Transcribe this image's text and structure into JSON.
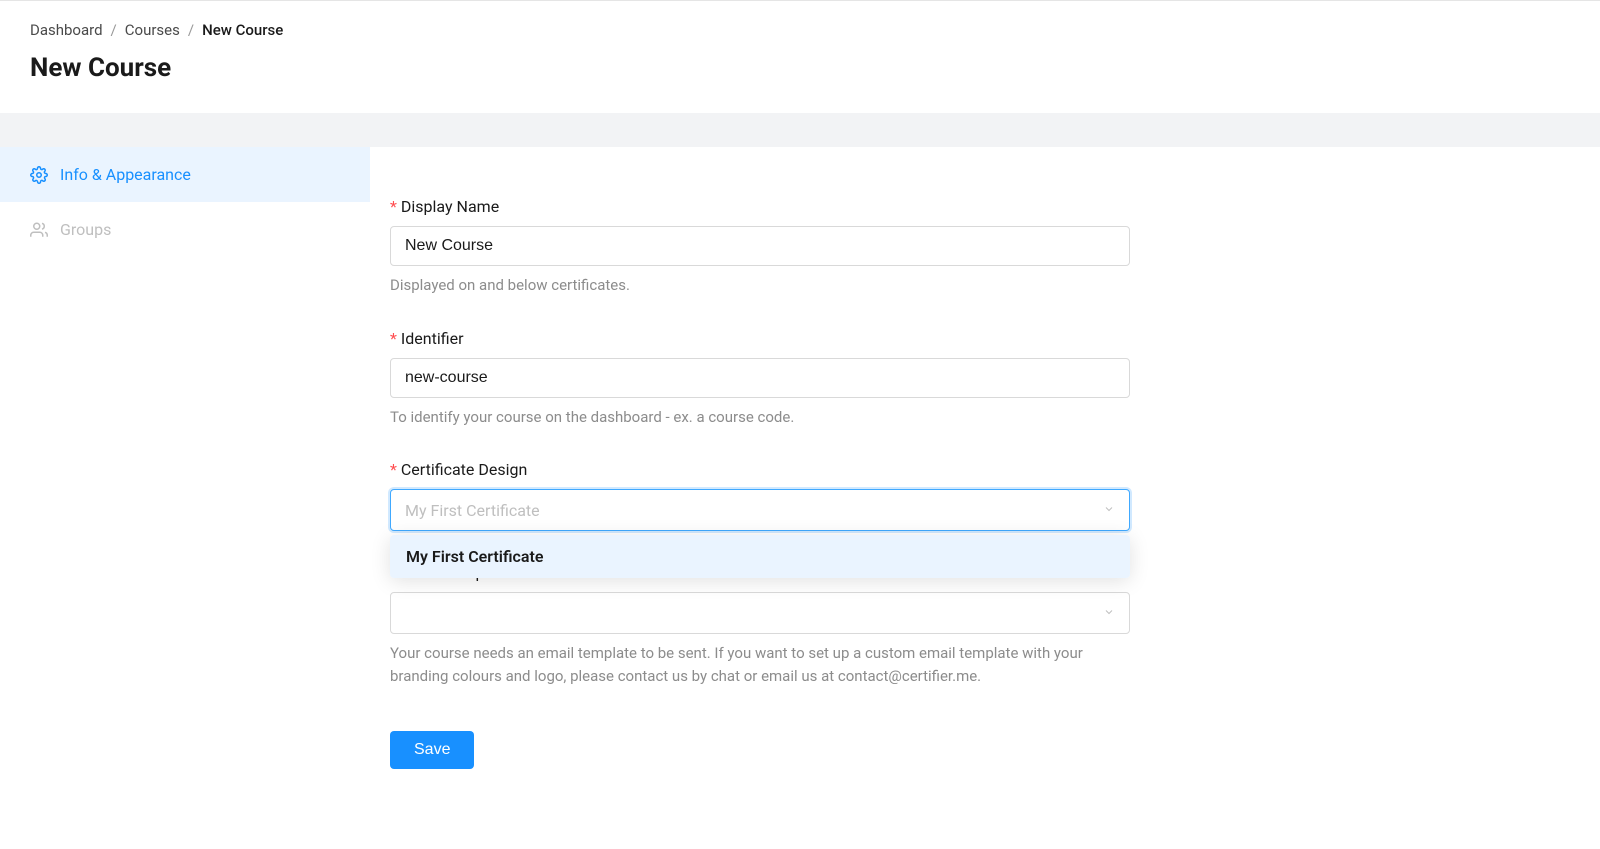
{
  "breadcrumb": {
    "items": [
      {
        "label": "Dashboard"
      },
      {
        "label": "Courses"
      }
    ],
    "current": "New Course"
  },
  "pageTitle": "New Course",
  "sidebar": {
    "items": [
      {
        "label": "Info & Appearance"
      },
      {
        "label": "Groups"
      }
    ]
  },
  "form": {
    "displayName": {
      "label": "Display Name",
      "value": "New Course",
      "help": "Displayed on and below certificates."
    },
    "identifier": {
      "label": "Identifier",
      "value": "new-course",
      "help": "To identify your course on the dashboard - ex. a course code."
    },
    "certificateDesign": {
      "label": "Certificate Design",
      "placeholder": "My First Certificate",
      "options": [
        {
          "label": "My First Certificate"
        }
      ]
    },
    "emailTemplate": {
      "label": "Email Template",
      "help": "Your course needs an email template to be sent. If you want to set up a custom email template with your branding colours and logo, please contact us by chat or email us at contact@certifier.me."
    },
    "saveLabel": "Save"
  }
}
